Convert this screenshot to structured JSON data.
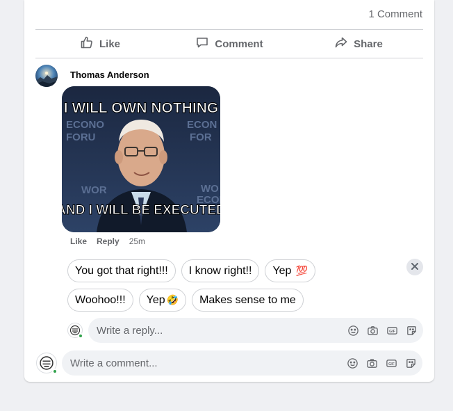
{
  "post": {
    "comment_count": "1 Comment",
    "actions": {
      "like": "Like",
      "comment": "Comment",
      "share": "Share"
    }
  },
  "comment": {
    "author": "Thomas Anderson",
    "meme_top_text": "I WILL OWN NOTHING",
    "meme_bottom_text": "AND I WILL BE EXECUTED",
    "meme_bg_words": [
      "ECONO",
      "FORU",
      "ECON",
      "FOR",
      "WOR",
      "WO",
      "ECON"
    ],
    "like": "Like",
    "reply": "Reply",
    "time": "25m"
  },
  "suggestions": {
    "row1": [
      "You got that right!!!",
      "I know right!!",
      "Yep"
    ],
    "row1_emoji": "💯",
    "row2": [
      "Woohoo!!!",
      "Yep",
      "Makes sense to me"
    ],
    "row2_emoji": "🤣"
  },
  "reply_box": {
    "placeholder": "Write a reply..."
  },
  "comment_box": {
    "placeholder": "Write a comment..."
  },
  "colors": {
    "secondary_text": "#65676b",
    "online": "#31a24c",
    "input_bg": "#f0f2f5"
  }
}
